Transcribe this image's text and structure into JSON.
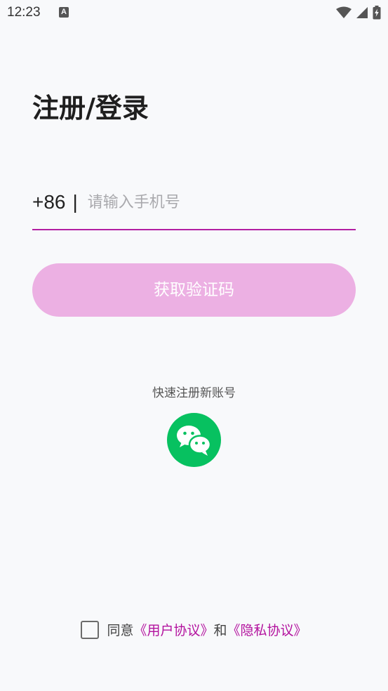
{
  "status_bar": {
    "time": "12:23",
    "notification_icon_letter": "A",
    "icons": [
      "wifi-icon",
      "signal-icon",
      "battery-charging-icon"
    ]
  },
  "page": {
    "title": "注册/登录"
  },
  "phone": {
    "country_code": "+86",
    "divider": "|",
    "placeholder": "请输入手机号",
    "value": ""
  },
  "get_code_button": {
    "label": "获取验证码"
  },
  "quick_register": {
    "label": "快速注册新账号",
    "icon": "wechat-icon"
  },
  "agreement": {
    "prefix": "同意",
    "user_agreement": "《用户协议》",
    "conjunction": "和",
    "privacy_agreement": "《隐私协议》",
    "checked": false
  },
  "colors": {
    "background": "#f8f9fb",
    "accent": "#b31ea2",
    "button_disabled": "#ecb0e3",
    "link": "#b3129e",
    "wechat_green": "#07c160"
  }
}
